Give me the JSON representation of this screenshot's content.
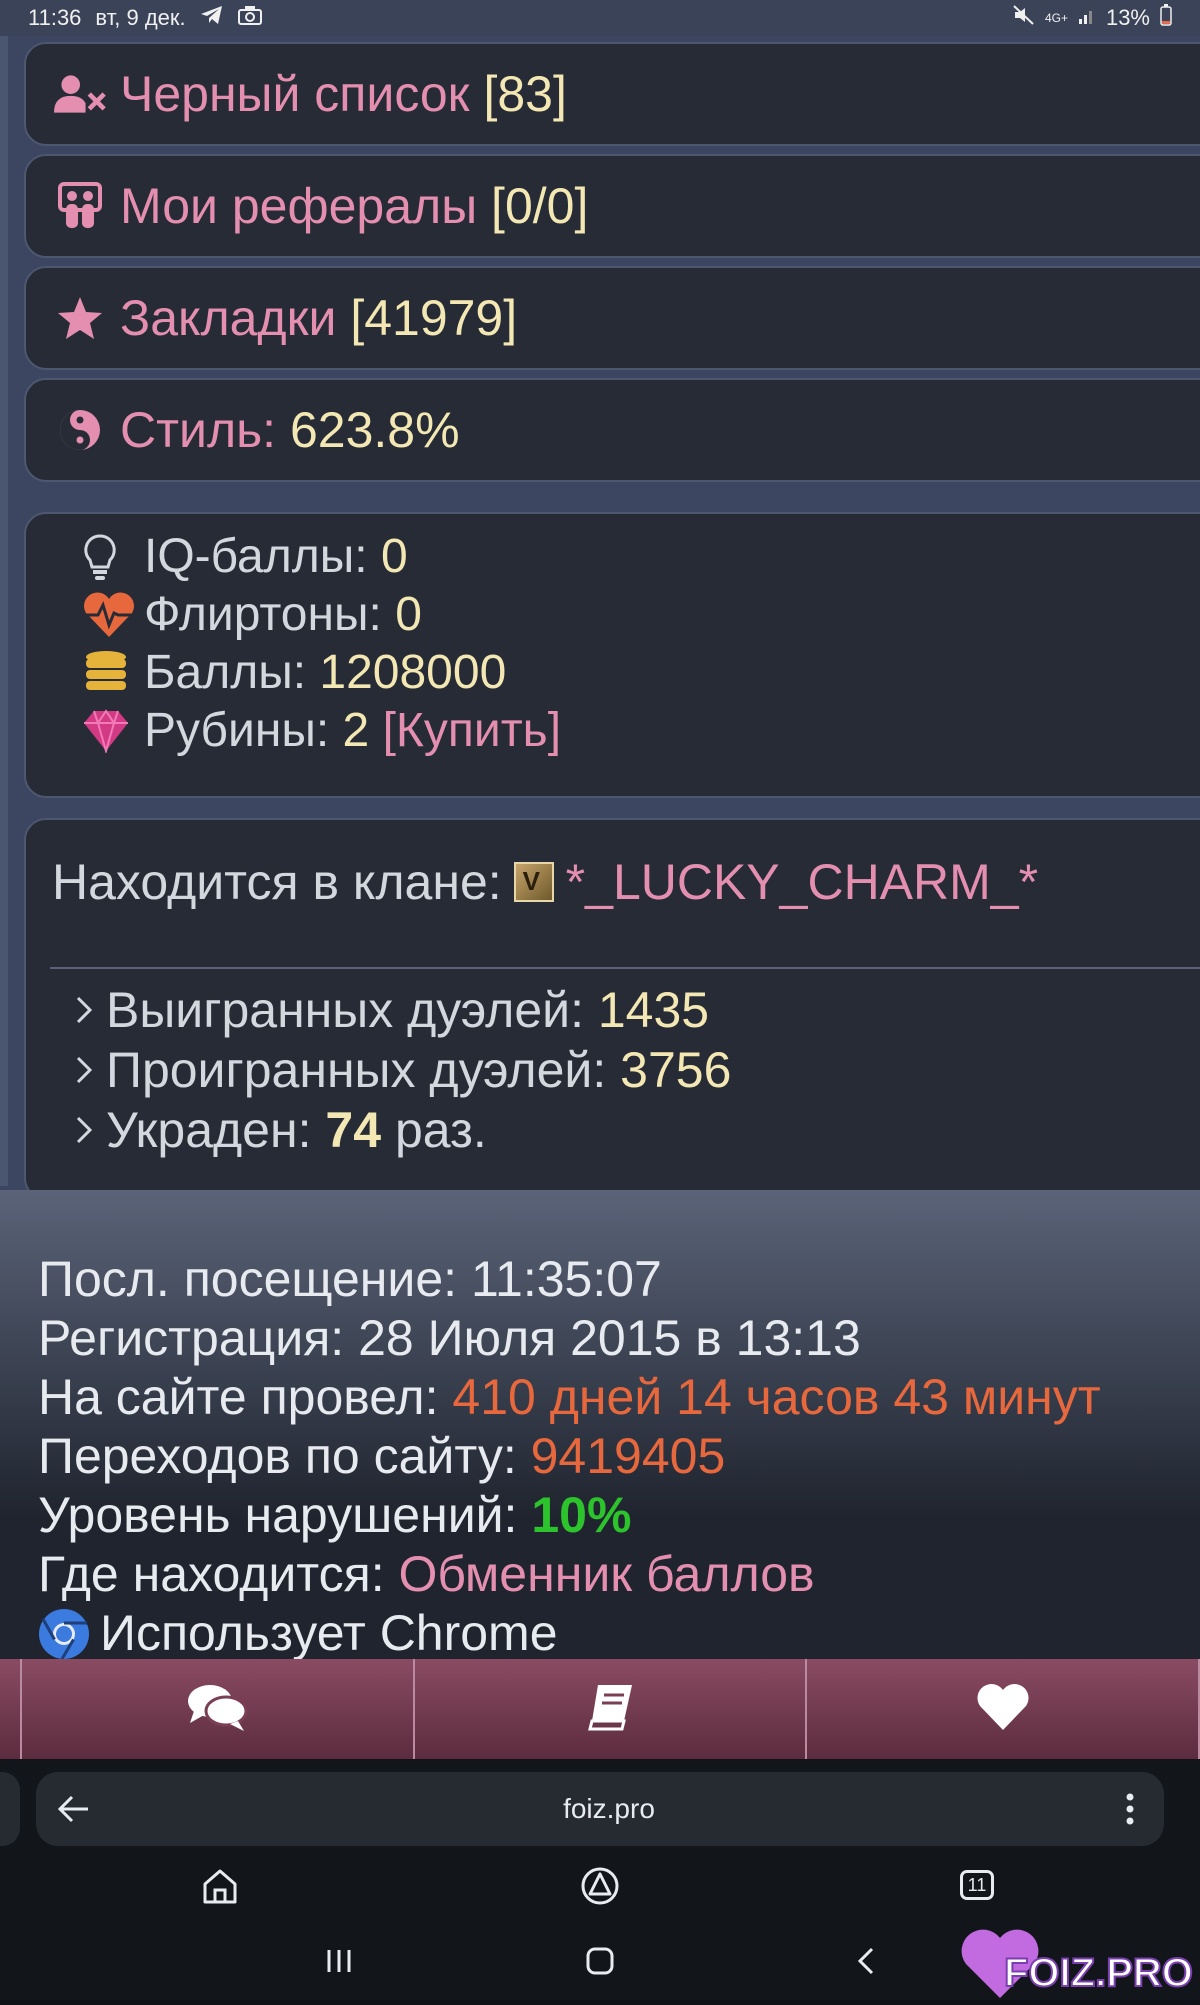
{
  "status": {
    "time": "11:36",
    "date": "вт, 9 дек.",
    "battery": "13%",
    "network": "4G+"
  },
  "rows": [
    {
      "label": "Черный список",
      "value": "[83]",
      "icon": "user-block-icon"
    },
    {
      "label": "Мои рефералы",
      "value": "[0/0]",
      "icon": "referrals-icon"
    },
    {
      "label": "Закладки",
      "value": "[41979]",
      "icon": "star-icon"
    },
    {
      "label": "Стиль:",
      "value": "623.8%",
      "icon": "yin-yang-icon"
    }
  ],
  "stats": [
    {
      "label": "IQ-баллы:",
      "value": "0",
      "icon": "lightbulb-icon"
    },
    {
      "label": "Флиртоны:",
      "value": "0",
      "icon": "heartbeat-icon"
    },
    {
      "label": "Баллы:",
      "value": "1208000",
      "icon": "coins-icon"
    },
    {
      "label": "Рубины:",
      "value": "2",
      "link": "[Купить]",
      "icon": "ruby-icon"
    }
  ],
  "clan": {
    "label": "Находится в клане:",
    "name": "*_LUCKY_CHARM_*",
    "won_label": "Выигранных дуэлей:",
    "won": "1435",
    "lost_label": "Проигранных дуэлей:",
    "lost": "3756",
    "stolen_label": "Украден:",
    "stolen": "74",
    "stolen_suffix": "раз."
  },
  "info": {
    "last_visit_label": "Посл. посещение:",
    "last_visit": "11:35:07",
    "registration_label": "Регистрация:",
    "registration": "28 Июля 2015 в 13:13",
    "time_spent_label": "На сайте провел:",
    "time_spent": "410 дней 14 часов 43 минут",
    "visits_label": "Переходов по сайту:",
    "visits": "9419405",
    "violations_label": "Уровень нарушений:",
    "violations": "10%",
    "location_label": "Где находится:",
    "location": "Обменник баллов",
    "browser_text": "Использует Chrome"
  },
  "browser": {
    "url": "foiz.pro",
    "tabs": "11"
  },
  "watermark": "FOIZ.PRO",
  "colors": {
    "pink": "#e48fb0",
    "yellow": "#f3e7b3",
    "orange": "#e8683e",
    "green": "#2cc32c",
    "nav": "#7a3f55"
  }
}
